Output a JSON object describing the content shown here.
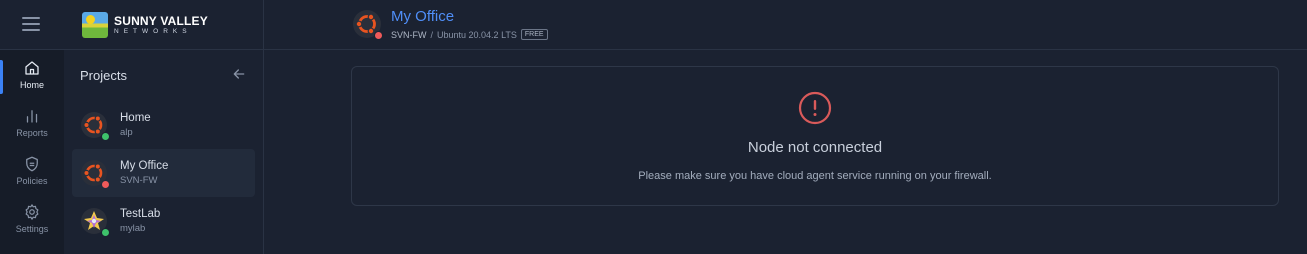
{
  "brand": {
    "title": "SUNNY VALLEY",
    "subtitle": "NETWORKS"
  },
  "rail": {
    "items": [
      {
        "label": "Home",
        "icon": "home-icon",
        "active": true
      },
      {
        "label": "Reports",
        "icon": "bar-chart-icon",
        "active": false
      },
      {
        "label": "Policies",
        "icon": "shield-icon",
        "active": false
      },
      {
        "label": "Settings",
        "icon": "gear-icon",
        "active": false
      }
    ]
  },
  "projects": {
    "title": "Projects",
    "items": [
      {
        "name": "Home",
        "sub": "alp",
        "icon": "ubuntu-icon",
        "status": "online",
        "status_color": "#3ec26b",
        "selected": false
      },
      {
        "name": "My Office",
        "sub": "SVN-FW",
        "icon": "ubuntu-icon",
        "status": "offline",
        "status_color": "#ef5a5a",
        "selected": true
      },
      {
        "name": "TestLab",
        "sub": "mylab",
        "icon": "opnsense-icon",
        "status": "online",
        "status_color": "#3ec26b",
        "selected": false
      }
    ]
  },
  "header": {
    "title": "My Office",
    "node": "SVN-FW",
    "separator": "/",
    "os": "Ubuntu 20.04.2 LTS",
    "plan_badge": "FREE"
  },
  "card": {
    "title": "Node not connected",
    "message": "Please make sure you have cloud agent service running on your firewall."
  },
  "colors": {
    "accent": "#3b82f6",
    "link": "#4f8ef7",
    "error": "#ef5a5a",
    "online": "#3ec26b",
    "ubuntu": "#e95420"
  }
}
